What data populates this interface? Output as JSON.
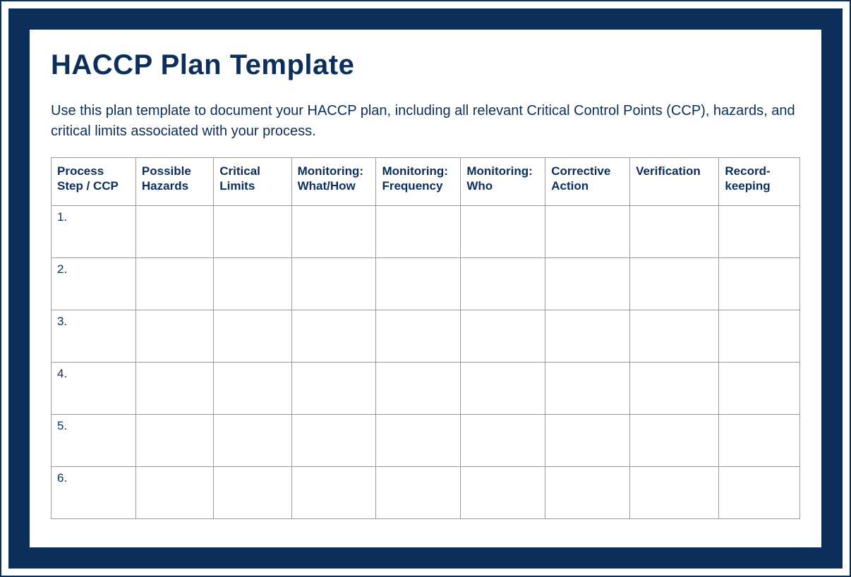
{
  "title": "HACCP Plan Template",
  "description": "Use this plan template to document your HACCP plan, including all relevant Critical Control Points (CCP), hazards, and critical limits associated with your process.",
  "columns": [
    "Process Step / CCP",
    "Possible Hazards",
    "Critical Limits",
    "Monitoring: What/How",
    "Monitoring: Frequency",
    "Monitoring: Who",
    "Corrective Action",
    "Verification",
    "Record-keeping"
  ],
  "rows": [
    {
      "num": "1.",
      "cells": [
        "",
        "",
        "",
        "",
        "",
        "",
        "",
        ""
      ]
    },
    {
      "num": "2.",
      "cells": [
        "",
        "",
        "",
        "",
        "",
        "",
        "",
        ""
      ]
    },
    {
      "num": "3.",
      "cells": [
        "",
        "",
        "",
        "",
        "",
        "",
        "",
        ""
      ]
    },
    {
      "num": "4.",
      "cells": [
        "",
        "",
        "",
        "",
        "",
        "",
        "",
        ""
      ]
    },
    {
      "num": "5.",
      "cells": [
        "",
        "",
        "",
        "",
        "",
        "",
        "",
        ""
      ]
    },
    {
      "num": "6.",
      "cells": [
        "",
        "",
        "",
        "",
        "",
        "",
        "",
        ""
      ]
    }
  ]
}
